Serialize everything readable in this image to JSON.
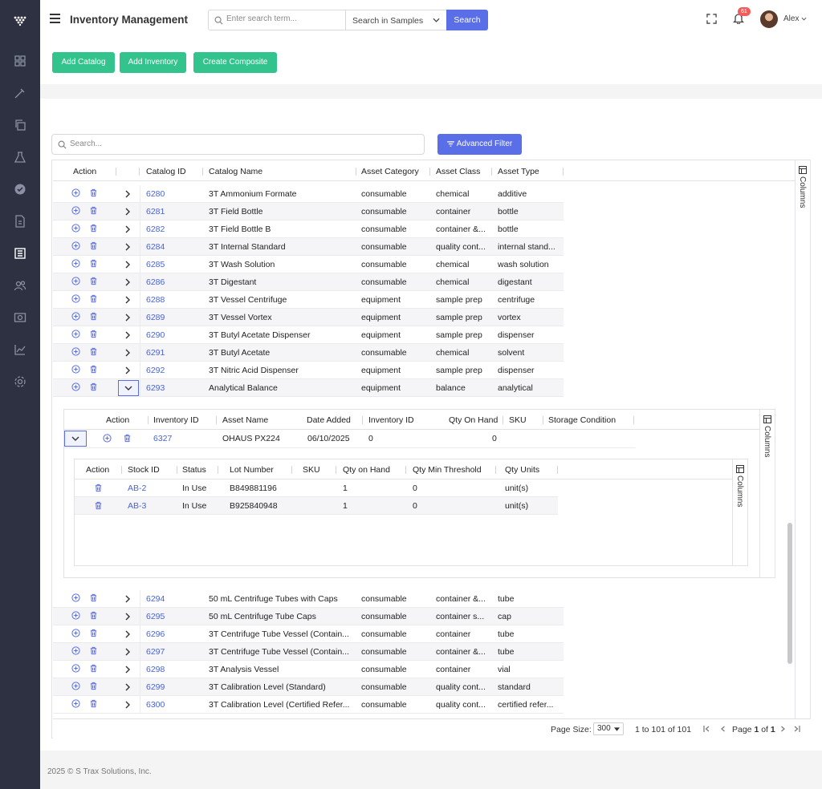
{
  "header": {
    "title": "Inventory Management",
    "search_placeholder": "Enter search term...",
    "search_scope": "Search in Samples",
    "search_button": "Search",
    "notification_count": "61",
    "user_name": "Alex"
  },
  "actions": {
    "add_catalog": "Add Catalog",
    "add_inventory": "Add Inventory",
    "create_composite": "Create Composite"
  },
  "grid": {
    "search_placeholder": "Search...",
    "advanced_filter": "Advanced Filter",
    "columns_label": "Columns",
    "headers": [
      "Action",
      "Catalog ID",
      "Catalog Name",
      "Asset Category",
      "Asset Class",
      "Asset Type"
    ],
    "rows_top": [
      {
        "id": "6280",
        "name": "3T Ammonium Formate",
        "category": "consumable",
        "class": "chemical",
        "type": "additive"
      },
      {
        "id": "6281",
        "name": "3T Field Bottle",
        "category": "consumable",
        "class": "container",
        "type": "bottle"
      },
      {
        "id": "6282",
        "name": "3T Field Bottle B",
        "category": "consumable",
        "class": "container &...",
        "type": "bottle"
      },
      {
        "id": "6284",
        "name": "3T Internal Standard",
        "category": "consumable",
        "class": "quality cont...",
        "type": "internal stand..."
      },
      {
        "id": "6285",
        "name": "3T Wash Solution",
        "category": "consumable",
        "class": "chemical",
        "type": "wash solution"
      },
      {
        "id": "6286",
        "name": "3T Digestant",
        "category": "consumable",
        "class": "chemical",
        "type": "digestant"
      },
      {
        "id": "6288",
        "name": "3T Vessel Centrifuge",
        "category": "equipment",
        "class": "sample prep",
        "type": "centrifuge"
      },
      {
        "id": "6289",
        "name": "3T Vessel Vortex",
        "category": "equipment",
        "class": "sample prep",
        "type": "vortex"
      },
      {
        "id": "6290",
        "name": "3T Butyl Acetate Dispenser",
        "category": "equipment",
        "class": "sample prep",
        "type": "dispenser"
      },
      {
        "id": "6291",
        "name": "3T Butyl Acetate",
        "category": "consumable",
        "class": "chemical",
        "type": "solvent"
      },
      {
        "id": "6292",
        "name": "3T Nitric Acid Dispenser",
        "category": "equipment",
        "class": "sample prep",
        "type": "dispenser"
      },
      {
        "id": "6293",
        "name": "Analytical Balance",
        "category": "equipment",
        "class": "balance",
        "type": "analytical"
      }
    ],
    "rows_bottom": [
      {
        "id": "6294",
        "name": "50 mL Centrifuge Tubes with Caps",
        "category": "consumable",
        "class": "container &...",
        "type": "tube"
      },
      {
        "id": "6295",
        "name": "50 mL Centrifuge Tube Caps",
        "category": "consumable",
        "class": "container s...",
        "type": "cap"
      },
      {
        "id": "6296",
        "name": "3T Centrifuge Tube Vessel (Contain...",
        "category": "consumable",
        "class": "container",
        "type": "tube"
      },
      {
        "id": "6297",
        "name": "3T Centrifuge Tube Vessel (Contain...",
        "category": "consumable",
        "class": "container &...",
        "type": "tube"
      },
      {
        "id": "6298",
        "name": "3T Analysis Vessel",
        "category": "consumable",
        "class": "container",
        "type": "vial"
      },
      {
        "id": "6299",
        "name": "3T Calibration Level (Standard)",
        "category": "consumable",
        "class": "quality cont...",
        "type": "standard"
      },
      {
        "id": "6300",
        "name": "3T Calibration Level (Certified Refer...",
        "category": "consumable",
        "class": "quality cont...",
        "type": "certified refer..."
      }
    ]
  },
  "inventory_detail": {
    "headers": [
      "Action",
      "Inventory ID",
      "Asset Name",
      "Date Added",
      "Inventory ID",
      "Qty On Hand",
      "SKU",
      "Storage Condition"
    ],
    "row": {
      "inventory_id": "6327",
      "asset_name": "OHAUS PX224",
      "date_added": "06/10/2025",
      "inventory_id2": "0",
      "qty_on_hand": "0"
    }
  },
  "stock_detail": {
    "headers": [
      "Action",
      "Stock ID",
      "Status",
      "Lot Number",
      "SKU",
      "Qty on Hand",
      "Qty Min Threshold",
      "Qty Units"
    ],
    "rows": [
      {
        "stock_id": "AB-2",
        "status": "In Use",
        "lot": "B849881196",
        "qty": "1",
        "min": "0",
        "units": "unit(s)"
      },
      {
        "stock_id": "AB-3",
        "status": "In Use",
        "lot": "B925840948",
        "qty": "1",
        "min": "0",
        "units": "unit(s)"
      }
    ]
  },
  "pagination": {
    "page_size_label": "Page Size:",
    "page_size": "300",
    "range": "1 to 101 of 101",
    "page_word": "Page",
    "page_current": "1",
    "of_word": "of",
    "page_total": "1"
  },
  "footer": {
    "copyright": "2025 © S Trax Solutions, Inc."
  },
  "colors": {
    "primary": "#5a6ee8",
    "success": "#33c48d",
    "sidebar": "#2e3142",
    "badge": "#f25c5c"
  }
}
